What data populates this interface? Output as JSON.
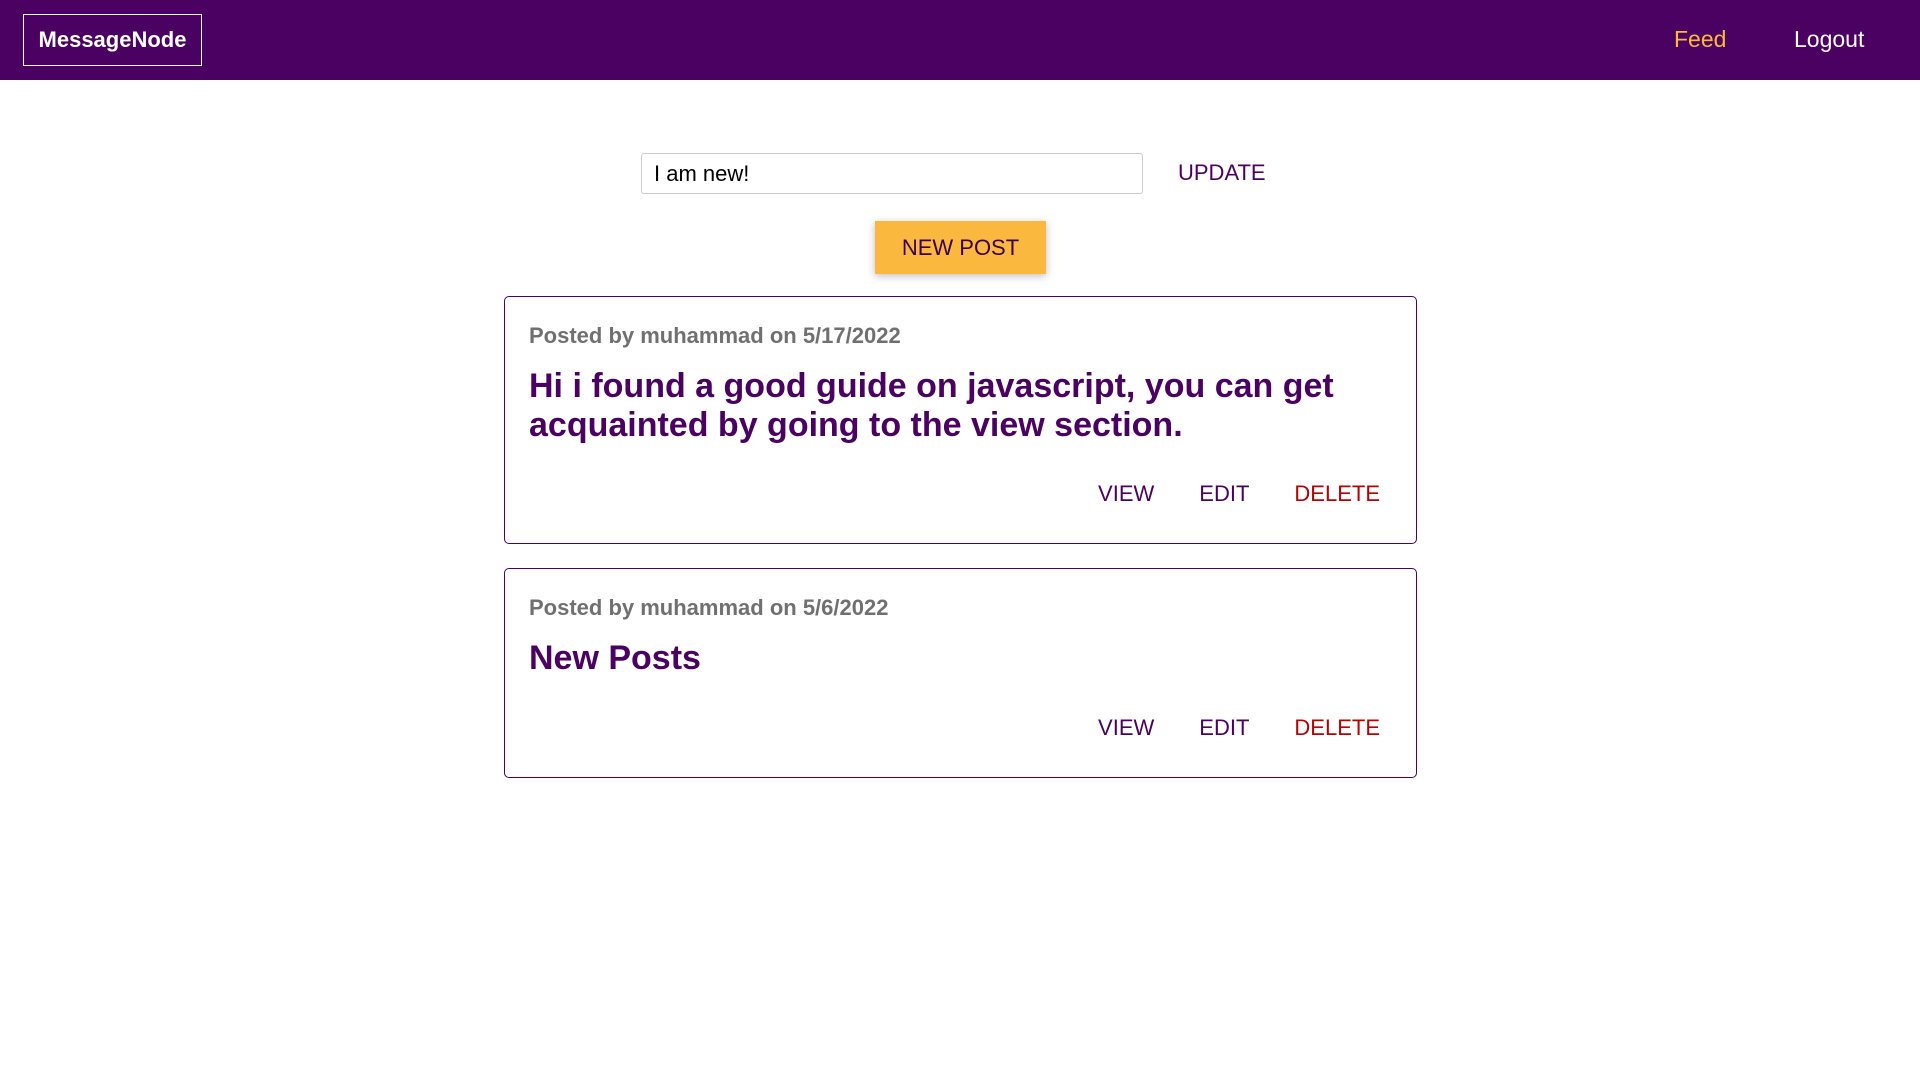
{
  "header": {
    "logo": "MessageNode",
    "nav": {
      "feed": "Feed",
      "logout": "Logout"
    }
  },
  "status": {
    "value": "I am new!",
    "update_label": "UPDATE"
  },
  "new_post_label": "NEW POST",
  "posts": [
    {
      "meta": "Posted by muhammad on 5/17/2022",
      "title": "Hi i found a good guide on javascript, you can get acquainted by going to the view section.",
      "actions": {
        "view": "VIEW",
        "edit": "EDIT",
        "delete": "DELETE"
      }
    },
    {
      "meta": "Posted by muhammad on 5/6/2022",
      "title": "New Posts",
      "actions": {
        "view": "VIEW",
        "edit": "EDIT",
        "delete": "DELETE"
      }
    }
  ],
  "colors": {
    "primary": "#4a0161",
    "accent": "#fab83f",
    "danger": "#b50202",
    "meta_text": "#707070"
  }
}
